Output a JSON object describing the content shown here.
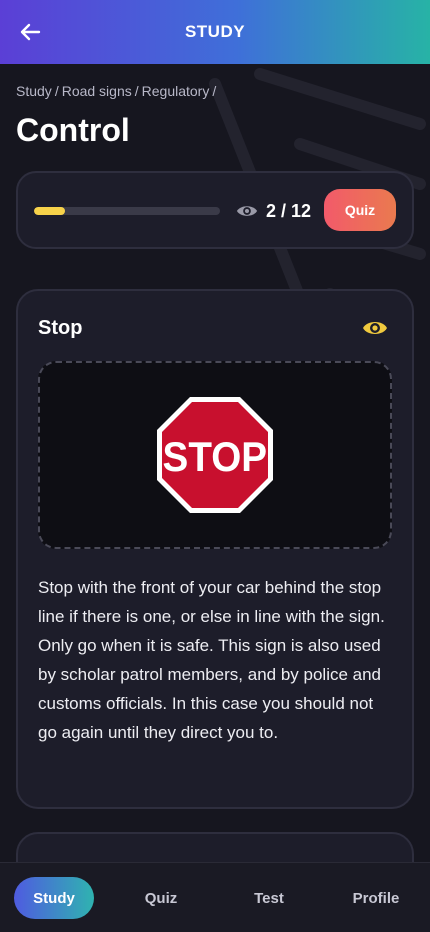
{
  "header": {
    "title": "STUDY",
    "back_icon": "arrow-left-icon"
  },
  "breadcrumb": [
    "Study",
    "Road signs",
    "Regulatory"
  ],
  "breadcrumb_separator": "/",
  "page_title": "Control",
  "progress": {
    "current": 2,
    "total": 12,
    "fraction": 0.1667,
    "label": "2 / 12",
    "quiz_label": "Quiz"
  },
  "sign": {
    "title": "Stop",
    "image_text": "STOP",
    "description": "Stop with the front of your car behind the stop line if there is one, or else in line with the sign. Only go when it is safe. This sign is also used by scholar patrol members, and by police and customs officials. In this case you should not go again until they direct you to."
  },
  "bottom_nav": {
    "items": [
      "Study",
      "Quiz",
      "Test",
      "Profile"
    ],
    "active": "Study"
  },
  "colors": {
    "accent_yellow": "#f7d24a",
    "quiz_gradient_start": "#f25a6a",
    "quiz_gradient_end": "#ea7a4f",
    "header_gradient_start": "#5b3fd6",
    "header_gradient_end": "#27b3a6",
    "stop_red": "#c8102e"
  }
}
